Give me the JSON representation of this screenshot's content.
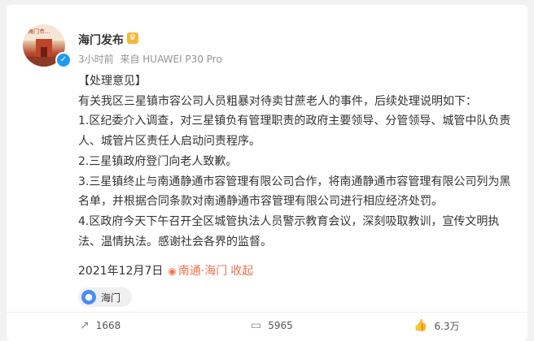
{
  "post": {
    "author": "海门发布",
    "meta": {
      "time": "3小时前",
      "source": "来自 HUAWEI P30 Pro"
    },
    "avatar_text": "海门市…",
    "lines": [
      "【处理意见】",
      "有关我区三星镇市容公司人员粗暴对待卖甘蔗老人的事件，后续处理说明如下：",
      "1.区纪委介入调查，对三星镇负有管理职责的政府主要领导、分管领导、城管中队负责人、城管片区责任人启动问责程序。",
      "2.三星镇政府登门向老人致歉。",
      "3.三星镇终止与南通静通市容管理有限公司合作，将南通静通市容管理有限公司列为黑名单，并根据合同条款对南通静通市容管理有限公司进行相应经济处罚。",
      "4.区政府今天下午召开全区城管执法人员警示教育会议，深刻吸取教训，宣传文明执法、温情执法。感谢社会各界的监督。"
    ],
    "date": "2021年12月7日",
    "location": "南通·海门",
    "collapse_label": "收起",
    "place_chip": "海门"
  },
  "actions": {
    "repost_count": "1668",
    "comment_count": "5965",
    "like_count": "6.3万"
  },
  "icons": {
    "verified": "verified-badge-icon",
    "vip": "crown-icon",
    "location": "location-pin-icon",
    "repost": "repost-icon",
    "comment": "comment-icon",
    "like": "like-icon"
  },
  "colors": {
    "accent": "#eb7350",
    "verified": "#1f9bf0",
    "place": "#4a8cf7"
  }
}
